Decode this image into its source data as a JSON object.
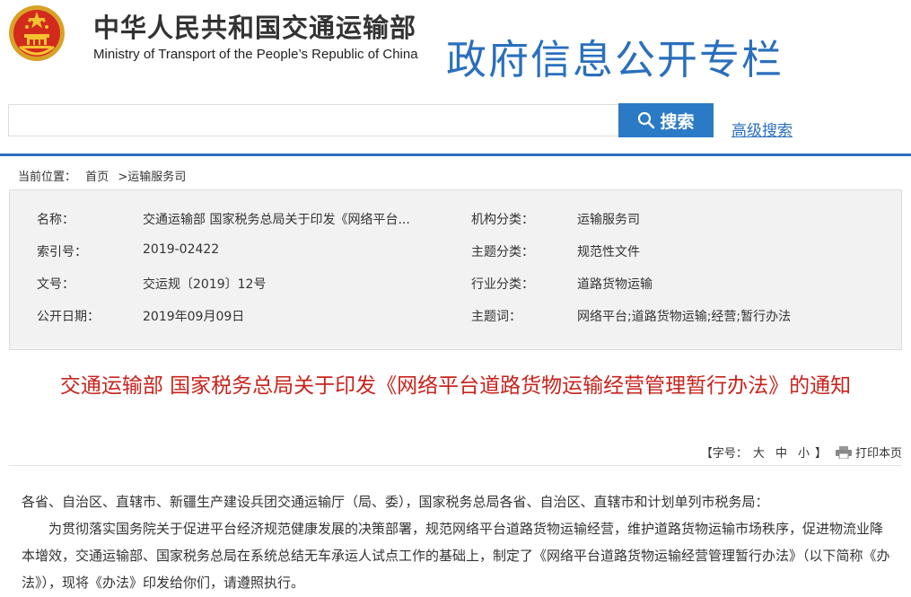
{
  "header": {
    "ministry_cn": "中华人民共和国交通运输部",
    "ministry_en": "Ministry of Transport of the People’s Republic of China",
    "column_title": "政府信息公开专栏"
  },
  "search": {
    "button_label": "搜索",
    "advanced_label": "高级搜索",
    "placeholder": ""
  },
  "breadcrumb": {
    "label": "当前位置：",
    "home": "首页",
    "separator": ">",
    "current": "运输服务司"
  },
  "info": {
    "rows": [
      {
        "k1": "名称：",
        "v1": "交通运输部 国家税务总局关于印发《网络平台...",
        "k2": "机构分类：",
        "v2": "运输服务司"
      },
      {
        "k1": "索引号：",
        "v1": "2019-02422",
        "k2": "主题分类：",
        "v2": "规范性文件"
      },
      {
        "k1": "文号：",
        "v1": "交运规〔2019〕12号",
        "k2": "行业分类：",
        "v2": "道路货物运输"
      },
      {
        "k1": "公开日期：",
        "v1": "2019年09月09日",
        "k2": "主题词：",
        "v2": "网络平台;道路货物运输;经营;暂行办法"
      }
    ]
  },
  "document": {
    "title": "交通运输部 国家税务总局关于印发《网络平台道路货物运输经营管理暂行办法》的通知",
    "font_label": "【字号：",
    "size_large": "大",
    "size_medium": "中",
    "size_small": "小",
    "font_end": "】",
    "print_label": "打印本页",
    "paragraphs": [
      "各省、自治区、直辖市、新疆生产建设兵团交通运输厅（局、委），国家税务总局各省、自治区、直辖市和计划单列市税务局：",
      "为贯彻落实国务院关于促进平台经济规范健康发展的决策部署，规范网络平台道路货物运输经营，维护道路货物运输市场秩序，促进物流业降本增效，交通运输部、国家税务总局在系统总结无车承运人试点工作的基础上，制定了《网络平台道路货物运输经营管理暂行办法》（以下简称《办法》），现将《办法》印发给你们，请遵照执行。"
    ]
  },
  "colors": {
    "accent_blue": "#2a6fbd",
    "title_red": "#c9231c",
    "info_bg": "#f2f2f2"
  }
}
